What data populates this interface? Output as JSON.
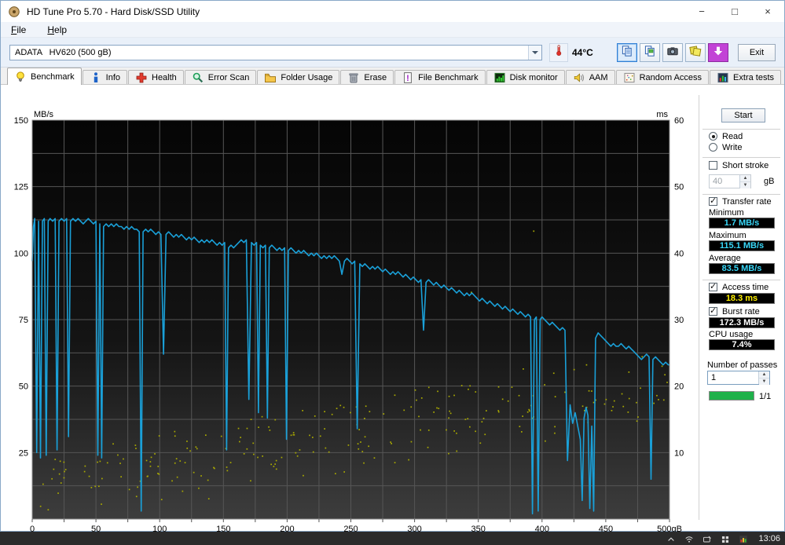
{
  "window": {
    "title": "HD Tune Pro 5.70 - Hard Disk/SSD Utility",
    "controls": {
      "minimize": "−",
      "maximize": "□",
      "close": "×"
    }
  },
  "menu": {
    "items": [
      "File",
      "Help"
    ]
  },
  "toolbar": {
    "drive": "ADATA   HV620 (500 gB)",
    "temperature": "44°C",
    "exit_label": "Exit"
  },
  "tabs": [
    {
      "label": "Benchmark",
      "icon": "benchmark"
    },
    {
      "label": "Info",
      "icon": "info"
    },
    {
      "label": "Health",
      "icon": "health"
    },
    {
      "label": "Error Scan",
      "icon": "error-scan"
    },
    {
      "label": "Folder Usage",
      "icon": "folder-usage"
    },
    {
      "label": "Erase",
      "icon": "erase"
    },
    {
      "label": "File Benchmark",
      "icon": "file-benchmark"
    },
    {
      "label": "Disk monitor",
      "icon": "disk-monitor"
    },
    {
      "label": "AAM",
      "icon": "aam"
    },
    {
      "label": "Random Access",
      "icon": "random-access"
    },
    {
      "label": "Extra tests",
      "icon": "extra-tests"
    }
  ],
  "active_tab": 0,
  "panel": {
    "start_label": "Start",
    "read_label": "Read",
    "write_label": "Write",
    "mode": "Read",
    "short_stroke_label": "Short stroke",
    "short_stroke_value": "40",
    "short_stroke_unit": "gB",
    "transfer_rate_label": "Transfer rate",
    "minimum_label": "Minimum",
    "minimum_value": "1.7 MB/s",
    "maximum_label": "Maximum",
    "maximum_value": "115.1 MB/s",
    "average_label": "Average",
    "average_value": "83.5 MB/s",
    "access_time_label": "Access time",
    "access_time_value": "18.3 ms",
    "burst_rate_label": "Burst rate",
    "burst_rate_value": "172.3 MB/s",
    "cpu_usage_label": "CPU usage",
    "cpu_usage_value": "7.4%",
    "passes_label": "Number of passes",
    "passes_value": "1",
    "passes_progress": "1/1",
    "checks": {
      "short_stroke": false,
      "transfer_rate": true,
      "access_time": true,
      "burst_rate": true
    }
  },
  "taskbar": {
    "time": "13:06"
  },
  "chart_data": {
    "type": "line+scatter",
    "x_axis": {
      "min": 0,
      "max": 500,
      "grid_step": 25,
      "ticks": [
        0,
        50,
        100,
        150,
        200,
        250,
        300,
        350,
        400,
        450,
        500
      ],
      "tick_labels": [
        "0",
        "50",
        "100",
        "150",
        "200",
        "250",
        "300",
        "350",
        "400",
        "450",
        "500gB"
      ]
    },
    "y_left": {
      "label": "MB/s",
      "min": 0,
      "max": 150,
      "grid_step": 12.5,
      "ticks": [
        150,
        125,
        100,
        75,
        50,
        25
      ]
    },
    "y_right": {
      "label": "ms",
      "min": 0,
      "max": 60,
      "ticks": [
        60,
        50,
        40,
        30,
        20,
        10
      ]
    },
    "transfer_rate": {
      "name": "Transfer rate",
      "unit": "MB/s",
      "color": "#1aa0d8",
      "summary": {
        "minimum": 1.7,
        "maximum": 115.1,
        "average": 83.5
      },
      "points": [
        [
          0,
          97
        ],
        [
          1,
          110
        ],
        [
          2,
          113
        ],
        [
          3.5,
          25
        ],
        [
          5,
          112
        ],
        [
          6.5,
          23
        ],
        [
          8,
          112
        ],
        [
          9.5,
          113
        ],
        [
          11,
          24
        ],
        [
          12.5,
          112
        ],
        [
          14,
          113
        ],
        [
          16,
          112
        ],
        [
          18,
          113
        ],
        [
          19.5,
          26
        ],
        [
          21,
          112
        ],
        [
          23,
          113
        ],
        [
          25,
          112
        ],
        [
          27,
          113
        ],
        [
          28.5,
          31
        ],
        [
          30,
          112
        ],
        [
          32,
          113
        ],
        [
          34,
          112
        ],
        [
          36,
          113
        ],
        [
          38,
          112
        ],
        [
          40,
          111
        ],
        [
          42,
          112
        ],
        [
          44,
          113
        ],
        [
          46,
          112
        ],
        [
          48,
          111
        ],
        [
          50,
          112
        ],
        [
          51.5,
          24
        ],
        [
          53,
          111
        ],
        [
          54.5,
          23
        ],
        [
          56,
          110
        ],
        [
          58,
          111
        ],
        [
          60,
          110
        ],
        [
          62,
          111
        ],
        [
          64,
          110
        ],
        [
          66,
          111
        ],
        [
          68,
          110
        ],
        [
          70,
          110
        ],
        [
          72,
          109
        ],
        [
          74,
          110
        ],
        [
          76,
          109
        ],
        [
          78,
          110
        ],
        [
          80,
          109
        ],
        [
          82,
          109
        ],
        [
          84,
          108
        ],
        [
          85.5,
          3
        ],
        [
          87,
          108
        ],
        [
          89,
          109
        ],
        [
          91,
          108
        ],
        [
          93,
          109
        ],
        [
          95,
          108
        ],
        [
          97,
          107
        ],
        [
          99,
          108
        ],
        [
          101,
          107
        ],
        [
          103,
          62
        ],
        [
          105,
          107
        ],
        [
          107,
          108
        ],
        [
          109,
          107
        ],
        [
          111,
          106
        ],
        [
          113,
          107
        ],
        [
          115,
          106
        ],
        [
          117,
          107
        ],
        [
          119,
          106
        ],
        [
          121,
          105
        ],
        [
          123,
          106
        ],
        [
          125,
          105
        ],
        [
          127,
          106
        ],
        [
          129,
          105
        ],
        [
          131,
          104
        ],
        [
          133,
          105
        ],
        [
          135,
          104
        ],
        [
          137,
          105
        ],
        [
          139,
          104
        ],
        [
          141,
          105
        ],
        [
          143,
          104
        ],
        [
          145,
          103
        ],
        [
          147,
          104
        ],
        [
          149,
          103
        ],
        [
          151,
          104
        ],
        [
          152.5,
          26
        ],
        [
          154,
          102
        ],
        [
          156,
          103
        ],
        [
          158,
          102
        ],
        [
          160,
          103
        ],
        [
          162,
          104
        ],
        [
          164,
          105
        ],
        [
          166,
          104
        ],
        [
          168,
          105
        ],
        [
          170,
          45
        ],
        [
          172,
          104
        ],
        [
          174,
          103
        ],
        [
          176,
          104
        ],
        [
          177.5,
          40
        ],
        [
          179,
          103
        ],
        [
          181,
          102
        ],
        [
          183,
          103
        ],
        [
          184.5,
          38
        ],
        [
          186,
          102
        ],
        [
          188,
          103
        ],
        [
          190,
          102
        ],
        [
          192,
          101
        ],
        [
          194,
          102
        ],
        [
          196,
          101
        ],
        [
          198,
          102
        ],
        [
          199.5,
          30
        ],
        [
          201,
          101
        ],
        [
          203,
          102
        ],
        [
          205,
          101
        ],
        [
          207,
          100
        ],
        [
          209,
          101
        ],
        [
          211,
          100
        ],
        [
          213,
          101
        ],
        [
          215,
          100
        ],
        [
          217,
          99
        ],
        [
          219,
          100
        ],
        [
          221,
          99
        ],
        [
          223,
          100
        ],
        [
          225,
          99
        ],
        [
          227,
          98
        ],
        [
          229,
          99
        ],
        [
          231,
          98
        ],
        [
          233,
          99
        ],
        [
          235,
          98
        ],
        [
          237,
          99
        ],
        [
          239,
          98
        ],
        [
          241,
          97
        ],
        [
          243,
          92
        ],
        [
          245,
          97
        ],
        [
          247,
          98
        ],
        [
          249,
          97
        ],
        [
          251,
          96
        ],
        [
          253,
          97
        ],
        [
          255,
          34
        ],
        [
          257,
          96
        ],
        [
          259,
          95
        ],
        [
          261,
          96
        ],
        [
          263,
          95
        ],
        [
          265,
          94
        ],
        [
          267,
          95
        ],
        [
          269,
          94
        ],
        [
          271,
          95
        ],
        [
          273,
          94
        ],
        [
          275,
          93
        ],
        [
          277,
          94
        ],
        [
          279,
          93
        ],
        [
          281,
          92
        ],
        [
          283,
          93
        ],
        [
          285,
          92
        ],
        [
          287,
          93
        ],
        [
          289,
          92
        ],
        [
          291,
          91
        ],
        [
          293,
          92
        ],
        [
          295,
          91
        ],
        [
          297,
          90
        ],
        [
          299,
          91
        ],
        [
          301,
          90
        ],
        [
          303,
          89
        ],
        [
          305,
          90
        ],
        [
          307,
          71
        ],
        [
          309,
          89
        ],
        [
          311,
          90
        ],
        [
          313,
          89
        ],
        [
          315,
          88
        ],
        [
          317,
          89
        ],
        [
          319,
          88
        ],
        [
          321,
          87
        ],
        [
          323,
          88
        ],
        [
          325,
          87
        ],
        [
          327,
          86
        ],
        [
          329,
          87
        ],
        [
          331,
          86
        ],
        [
          333,
          85
        ],
        [
          335,
          86
        ],
        [
          337,
          85
        ],
        [
          339,
          84
        ],
        [
          341,
          85
        ],
        [
          343,
          84
        ],
        [
          345,
          85
        ],
        [
          347,
          84
        ],
        [
          349,
          83
        ],
        [
          351,
          82
        ],
        [
          353,
          83
        ],
        [
          355,
          82
        ],
        [
          357,
          81
        ],
        [
          359,
          82
        ],
        [
          361,
          81
        ],
        [
          363,
          80
        ],
        [
          365,
          81
        ],
        [
          367,
          80
        ],
        [
          369,
          79
        ],
        [
          371,
          80
        ],
        [
          373,
          79
        ],
        [
          375,
          78
        ],
        [
          377,
          79
        ],
        [
          379,
          78
        ],
        [
          381,
          77
        ],
        [
          383,
          78
        ],
        [
          385,
          77
        ],
        [
          387,
          76
        ],
        [
          389,
          77
        ],
        [
          391,
          76
        ],
        [
          392.5,
          2
        ],
        [
          394,
          75
        ],
        [
          395.5,
          76
        ],
        [
          397,
          3
        ],
        [
          398.5,
          75
        ],
        [
          400,
          76
        ],
        [
          402,
          75
        ],
        [
          404,
          74
        ],
        [
          406,
          73
        ],
        [
          408,
          74
        ],
        [
          410,
          73
        ],
        [
          412,
          72
        ],
        [
          414,
          71
        ],
        [
          416,
          72
        ],
        [
          418,
          71
        ],
        [
          420,
          22
        ],
        [
          422,
          43
        ],
        [
          424,
          36
        ],
        [
          426,
          40
        ],
        [
          428,
          35
        ],
        [
          430,
          30
        ],
        [
          431.5,
          7
        ],
        [
          433,
          38
        ],
        [
          434.5,
          42
        ],
        [
          436,
          39
        ],
        [
          437.5,
          4
        ],
        [
          439,
          35
        ],
        [
          440.5,
          3
        ],
        [
          442,
          68
        ],
        [
          444,
          70
        ],
        [
          446,
          69
        ],
        [
          448,
          68
        ],
        [
          450,
          67
        ],
        [
          452,
          66
        ],
        [
          454,
          65
        ],
        [
          456,
          66
        ],
        [
          458,
          65
        ],
        [
          460,
          65
        ],
        [
          462,
          66
        ],
        [
          464,
          65
        ],
        [
          466,
          64
        ],
        [
          468,
          65
        ],
        [
          470,
          64
        ],
        [
          472,
          63
        ],
        [
          474,
          62
        ],
        [
          476,
          61
        ],
        [
          478,
          60
        ],
        [
          480,
          61
        ],
        [
          482,
          62
        ],
        [
          484,
          61
        ],
        [
          485.5,
          15
        ],
        [
          487,
          60
        ],
        [
          489,
          61
        ],
        [
          491,
          60
        ],
        [
          493,
          59
        ],
        [
          495,
          58
        ],
        [
          497,
          59
        ],
        [
          499,
          58
        ],
        [
          500,
          58
        ]
      ]
    },
    "access_time": {
      "name": "Access time",
      "unit": "ms",
      "color": "#a9a900",
      "average": 18.3,
      "scatter": {
        "seed": 13,
        "count": 240,
        "x_range": [
          2,
          498
        ],
        "ms_trend": [
          5,
          21
        ],
        "jitter_ms": 7.5,
        "clamp_ms": [
          1.5,
          27.5
        ]
      },
      "outliers": [
        [
          393,
          43.4
        ],
        [
          344,
          34.2
        ]
      ]
    }
  }
}
